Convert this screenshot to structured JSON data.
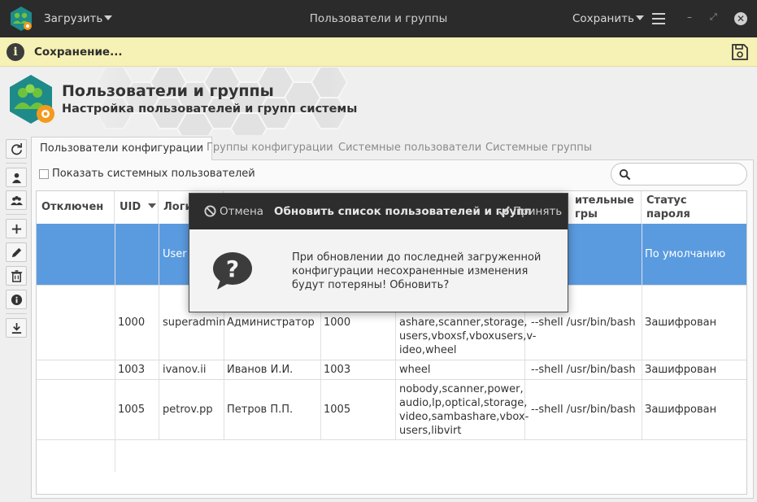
{
  "titlebar": {
    "load_label": "Загрузить",
    "title": "Пользователи и группы",
    "save_label": "Сохранить",
    "minimize_glyph": "–",
    "maximize_glyph": "⤢",
    "close_glyph": "✕"
  },
  "infobar": {
    "message": "Сохранение...",
    "icon_glyph": "i"
  },
  "header": {
    "title": "Пользователи и группы",
    "subtitle": "Настройка пользователей и групп системы"
  },
  "tabs": [
    {
      "label": "Пользователи конфигурации",
      "active": true
    },
    {
      "label": "Группы конфигурации",
      "active": false
    },
    {
      "label": "Системные пользователи",
      "active": false
    },
    {
      "label": "Системные группы",
      "active": false
    }
  ],
  "filter": {
    "show_system_users_label": "Показать системных пользователей",
    "show_system_users_checked": false,
    "search_placeholder": ""
  },
  "table": {
    "headers": {
      "disabled": "Отключен",
      "uid": "UID",
      "login": "Логин",
      "extra_options": "...ительные ...гры",
      "password_status": "Статус пароля"
    },
    "header_extra_line1": "ительные",
    "header_extra_line2": "гры",
    "header_status_line1": "Статус",
    "header_status_line2": "пароля",
    "header_login_partial": "Логи",
    "rows": [
      {
        "selected": true,
        "uid": "",
        "login": "User",
        "name": "",
        "group": "",
        "groups": "",
        "options": "",
        "password_status": "По умолчанию"
      },
      {
        "selected": false,
        "uid": "1000",
        "login": "superadmin",
        "name": "Администратор",
        "group": "1000",
        "groups_lines": [
          "ashare,scanner,storage,",
          "users,vboxsf,vboxusers,v-",
          "ideo,wheel"
        ],
        "options": "--shell /usr/bin/bash",
        "password_status": "Зашифрован"
      },
      {
        "selected": false,
        "uid": "1003",
        "login": "ivanov.ii",
        "name": "Иванов И.И.",
        "group": "1003",
        "groups_lines": [
          "wheel"
        ],
        "options": "--shell /usr/bin/bash",
        "password_status": "Зашифрован"
      },
      {
        "selected": false,
        "uid": "1005",
        "login": "petrov.pp",
        "name": "Петров П.П.",
        "group": "1005",
        "groups_lines": [
          "nobody,scanner,power,",
          "audio,lp,optical,storage,",
          "video,sambashare,vbox-",
          "users,libvirt"
        ],
        "options": "--shell /usr/bin/bash",
        "password_status": "Зашифрован"
      }
    ]
  },
  "dialog": {
    "cancel_label": "Отмена",
    "title": "Обновить список пользователей и групп",
    "ok_label": "Принять",
    "message": "При обновлении до последней загруженной конфигурации несохраненные изменения будут потеряны! Обновить?",
    "icon_glyph": "?"
  },
  "colors": {
    "titlebar_bg": "#2b2b2b",
    "infobar_bg": "#f6f1b4",
    "selection": "#5a9be0",
    "logo_teal": "#1f8a8a",
    "logo_green": "#6ec33c",
    "logo_orange": "#f39a1e"
  },
  "icons": {
    "app": "users-groups-app-icon",
    "info": "info-icon",
    "save_status": "save-disk-icon",
    "search": "search-icon",
    "refresh": "refresh-icon",
    "user": "user-icon",
    "group": "group-icon",
    "add": "add-icon",
    "edit": "edit-pencil-icon",
    "delete": "trash-icon",
    "details": "info-icon",
    "import": "download-icon"
  }
}
